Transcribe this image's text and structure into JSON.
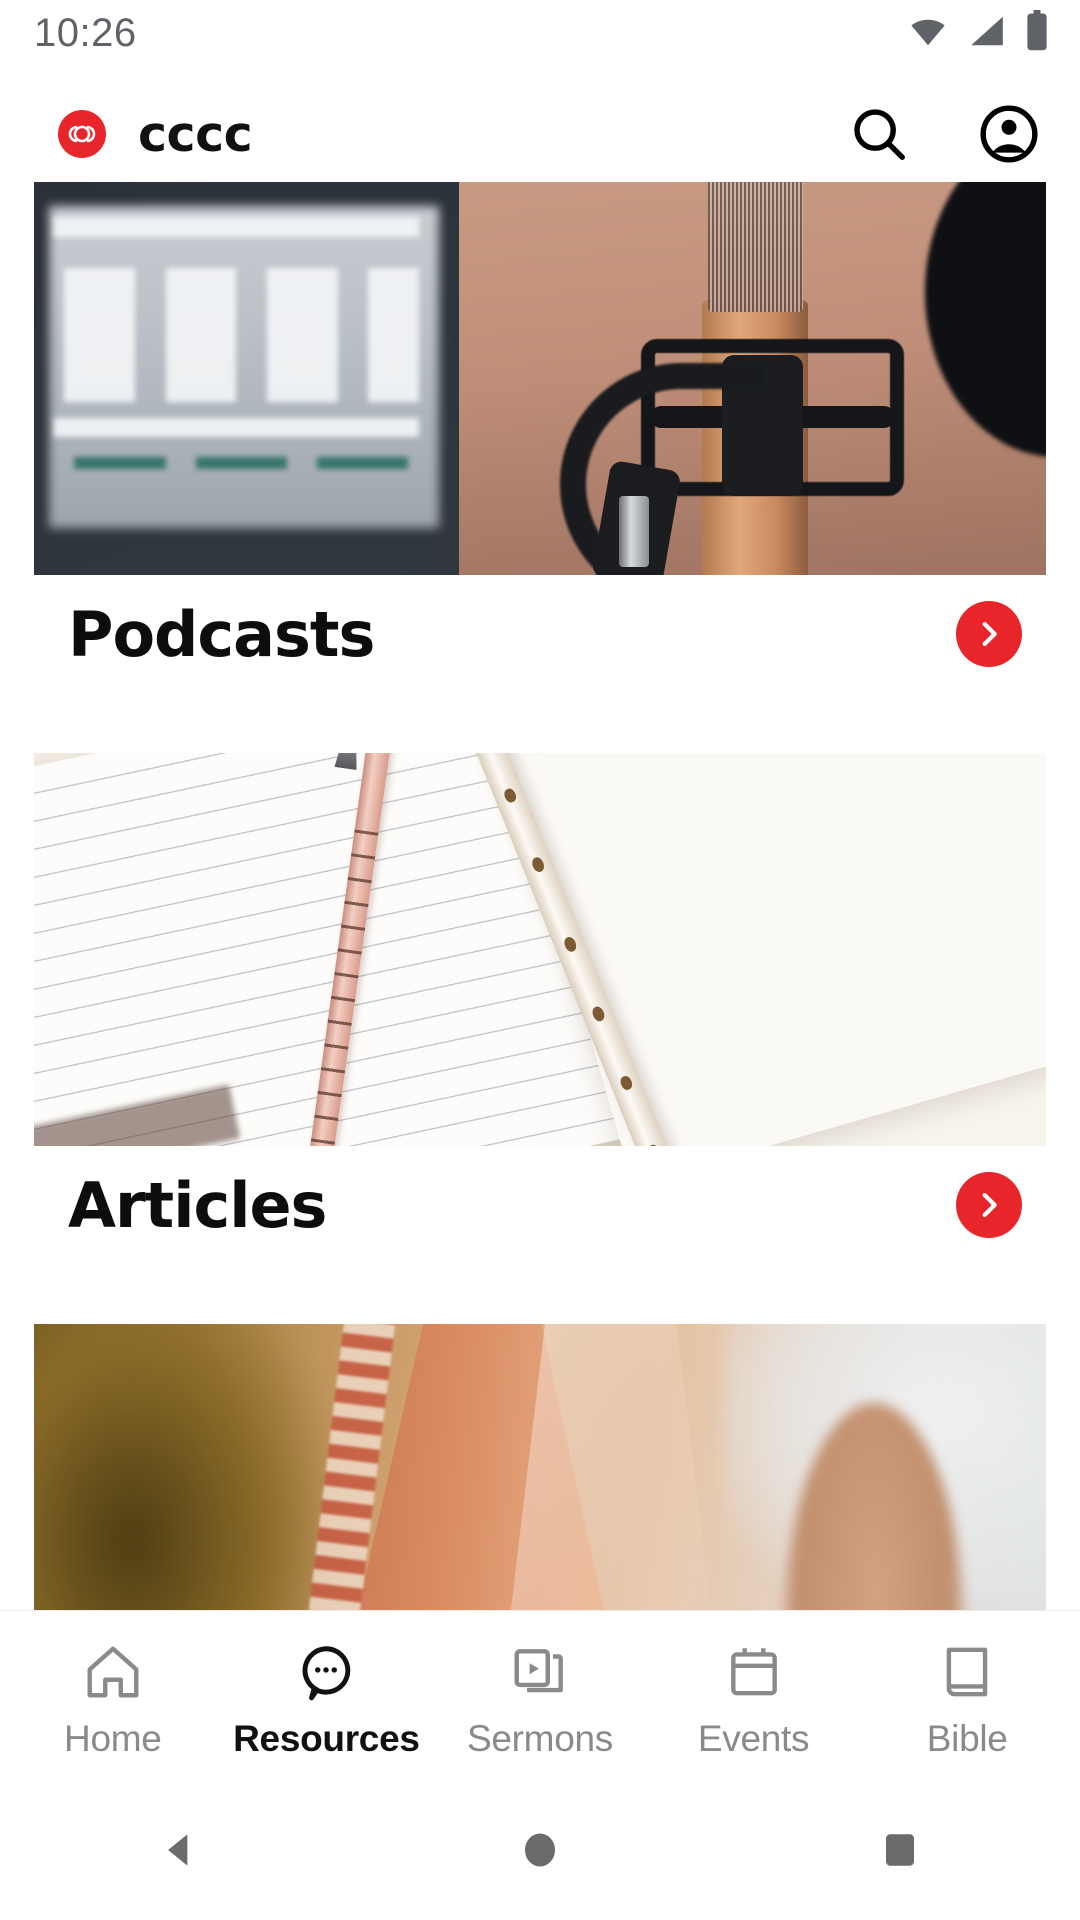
{
  "status_bar": {
    "clock": "10:26",
    "icons": [
      "wifi-icon",
      "cellular-signal-icon",
      "battery-icon"
    ]
  },
  "app_bar": {
    "logo_icon": "cccc-brand-logo-icon",
    "title": "cccc",
    "actions": [
      {
        "name": "search-icon",
        "label": "Search"
      },
      {
        "name": "account-circle-icon",
        "label": "Account"
      }
    ]
  },
  "theme": {
    "accent_red": "#e8252a",
    "background": "#ffffff",
    "text_primary": "#0d0d0d",
    "text_muted": "#8a8a8a"
  },
  "main": {
    "cards": [
      {
        "title": "Podcasts",
        "arrow_icon": "chevron-right-icon",
        "image_alt": "studio microphone with shock mount, headphones and blurred mixing console"
      },
      {
        "title": "Articles",
        "arrow_icon": "chevron-right-icon",
        "image_alt": "lined notebook with rose gold pen and cream flute crossing diagonally"
      },
      {
        "title": "",
        "arrow_icon": "chevron-right-icon",
        "image_alt": "warm golden sunset portrait partially visible"
      }
    ]
  },
  "bottom_nav": {
    "items": [
      {
        "label": "Home",
        "icon": "home-icon",
        "active": false
      },
      {
        "label": "Resources",
        "icon": "chat-bubble-dots-icon",
        "active": true
      },
      {
        "label": "Sermons",
        "icon": "video-library-icon",
        "active": false
      },
      {
        "label": "Events",
        "icon": "calendar-icon",
        "active": false
      },
      {
        "label": "Bible",
        "icon": "book-icon",
        "active": false
      }
    ]
  },
  "system_nav": {
    "buttons": [
      {
        "name": "back-triangle-icon",
        "label": "Back"
      },
      {
        "name": "home-circle-icon",
        "label": "Home"
      },
      {
        "name": "recents-square-icon",
        "label": "Recents"
      }
    ]
  }
}
